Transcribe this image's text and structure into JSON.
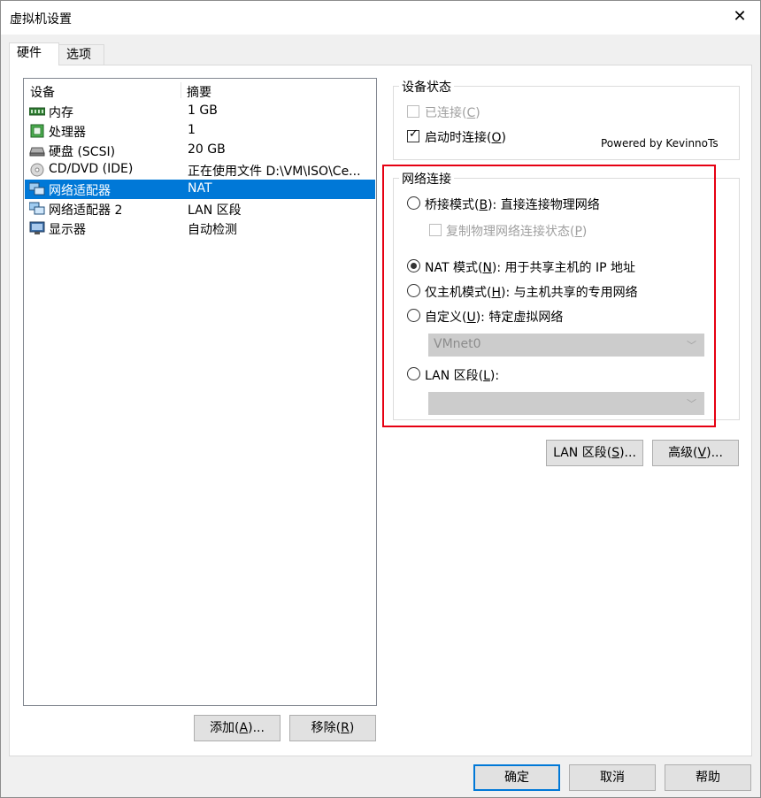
{
  "window": {
    "title": "虚拟机设置",
    "close_glyph": "✕"
  },
  "tabs": [
    {
      "label": "硬件",
      "active": true
    },
    {
      "label": "选项",
      "active": false
    }
  ],
  "device_list": {
    "headers": {
      "device": "设备",
      "summary": "摘要"
    },
    "rows": [
      {
        "name": "内存",
        "summary": "1 GB",
        "icon": "memory-icon",
        "selected": false
      },
      {
        "name": "处理器",
        "summary": "1",
        "icon": "processor-icon",
        "selected": false
      },
      {
        "name": "硬盘 (SCSI)",
        "summary": "20 GB",
        "icon": "hard-disk-icon",
        "selected": false
      },
      {
        "name": "CD/DVD (IDE)",
        "summary": "正在使用文件 D:\\VM\\ISO\\Ce...",
        "icon": "cd-dvd-icon",
        "selected": false
      },
      {
        "name": "网络适配器",
        "summary": "NAT",
        "icon": "network-adapter-icon",
        "selected": true
      },
      {
        "name": "网络适配器 2",
        "summary": "LAN 区段",
        "icon": "network-adapter-icon",
        "selected": false
      },
      {
        "name": "显示器",
        "summary": "自动检测",
        "icon": "display-icon",
        "selected": false
      }
    ]
  },
  "left_buttons": {
    "add": {
      "text": "添加(",
      "key": "A",
      "suffix": ")..."
    },
    "remove": {
      "text": "移除(",
      "key": "R",
      "suffix": ")"
    }
  },
  "device_status": {
    "title": "设备状态",
    "connected": {
      "text": "已连接(",
      "key": "C",
      "suffix": ")",
      "checked": false,
      "enabled": false
    },
    "connect_at_power_on": {
      "text": "启动时连接(",
      "key": "O",
      "suffix": ")",
      "checked": true,
      "enabled": true
    },
    "powered_by": "Powered by KevinnoTs"
  },
  "network_connection": {
    "title": "网络连接",
    "bridged": {
      "text": "桥接模式(",
      "key": "B",
      "suffix": "): 直接连接物理网络",
      "selected": false
    },
    "replicate": {
      "text": "复制物理网络连接状态(",
      "key": "P",
      "suffix": ")",
      "checked": false,
      "enabled": false
    },
    "nat": {
      "text": "NAT 模式(",
      "key": "N",
      "suffix": "): 用于共享主机的 IP 地址",
      "selected": true
    },
    "host_only": {
      "text": "仅主机模式(",
      "key": "H",
      "suffix": "): 与主机共享的专用网络",
      "selected": false
    },
    "custom": {
      "text": "自定义(",
      "key": "U",
      "suffix": "): 特定虚拟网络",
      "selected": false
    },
    "custom_select": {
      "value": "VMnet0",
      "enabled": false
    },
    "lan_segment": {
      "text": "LAN 区段(",
      "key": "L",
      "suffix": "):",
      "selected": false
    },
    "lan_select": {
      "value": "",
      "enabled": false
    }
  },
  "right_buttons": {
    "lan_segments": {
      "text": "LAN 区段(",
      "key": "S",
      "suffix": ")..."
    },
    "advanced": {
      "text": "高级(",
      "key": "V",
      "suffix": ")..."
    }
  },
  "footer": {
    "ok": "确定",
    "cancel": "取消",
    "help": "帮助"
  },
  "colors": {
    "selection": "#0078d7",
    "highlight_box": "#e60012"
  }
}
